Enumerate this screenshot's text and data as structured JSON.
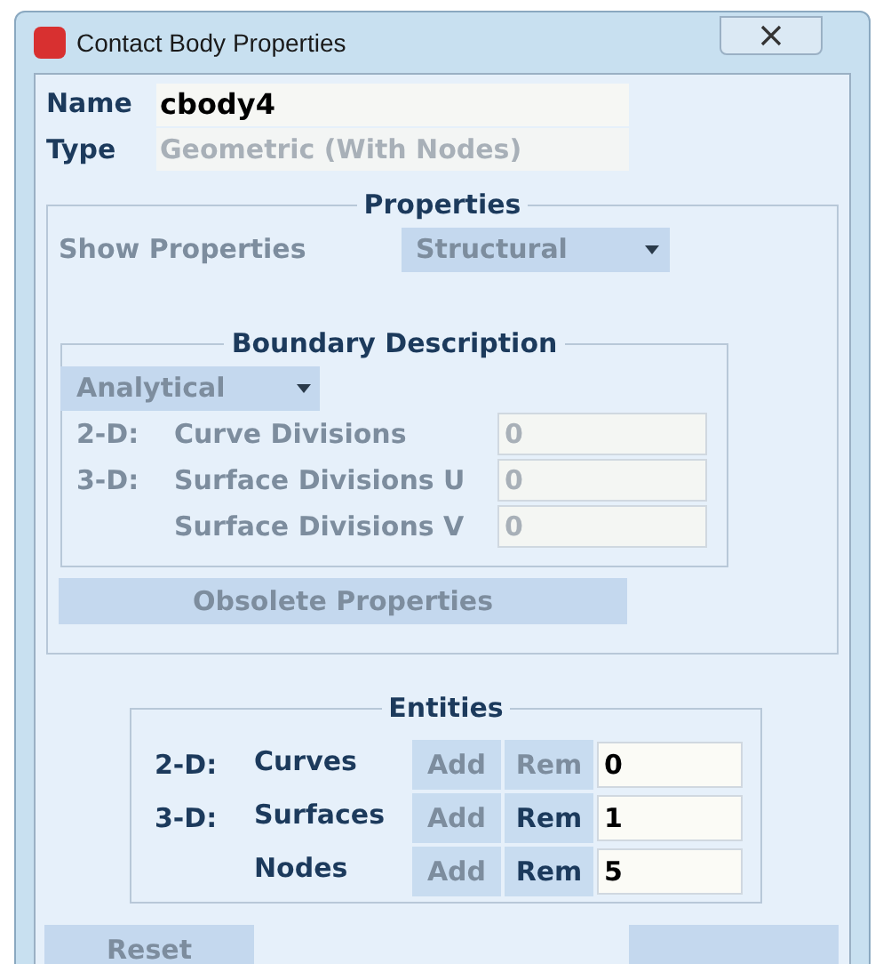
{
  "window": {
    "title": "Contact Body Properties"
  },
  "name": {
    "label": "Name",
    "value": "cbody4"
  },
  "type": {
    "label": "Type",
    "value": "Geometric (With Nodes)"
  },
  "properties": {
    "title": "Properties",
    "show_label": "Show Properties",
    "show_value": "Structural",
    "disabled": true,
    "boundary": {
      "title": "Boundary Description",
      "method": "Analytical",
      "rows": [
        {
          "dim": "2-D:",
          "label": "Curve Divisions",
          "value": "0"
        },
        {
          "dim": "3-D:",
          "label": "Surface Divisions U",
          "value": "0"
        },
        {
          "label": "Surface Divisions V",
          "value": "0"
        }
      ]
    },
    "obsolete_button": "Obsolete Properties"
  },
  "entities": {
    "title": "Entities",
    "rows": [
      {
        "dim": "2-D:",
        "label": "Curves",
        "add": {
          "label": "Add",
          "disabled": true
        },
        "rem": {
          "label": "Rem",
          "disabled": true
        },
        "count": "0"
      },
      {
        "dim": "3-D:",
        "label": "Surfaces",
        "add": {
          "label": "Add",
          "disabled": true
        },
        "rem": {
          "label": "Rem",
          "disabled": false
        },
        "count": "1"
      },
      {
        "label": "Nodes",
        "add": {
          "label": "Add",
          "disabled": true
        },
        "rem": {
          "label": "Rem",
          "disabled": false
        },
        "count": "5"
      }
    ]
  },
  "buttons": [
    {
      "label": "Reset",
      "disabled": true
    },
    {
      "disabled": true
    }
  ]
}
